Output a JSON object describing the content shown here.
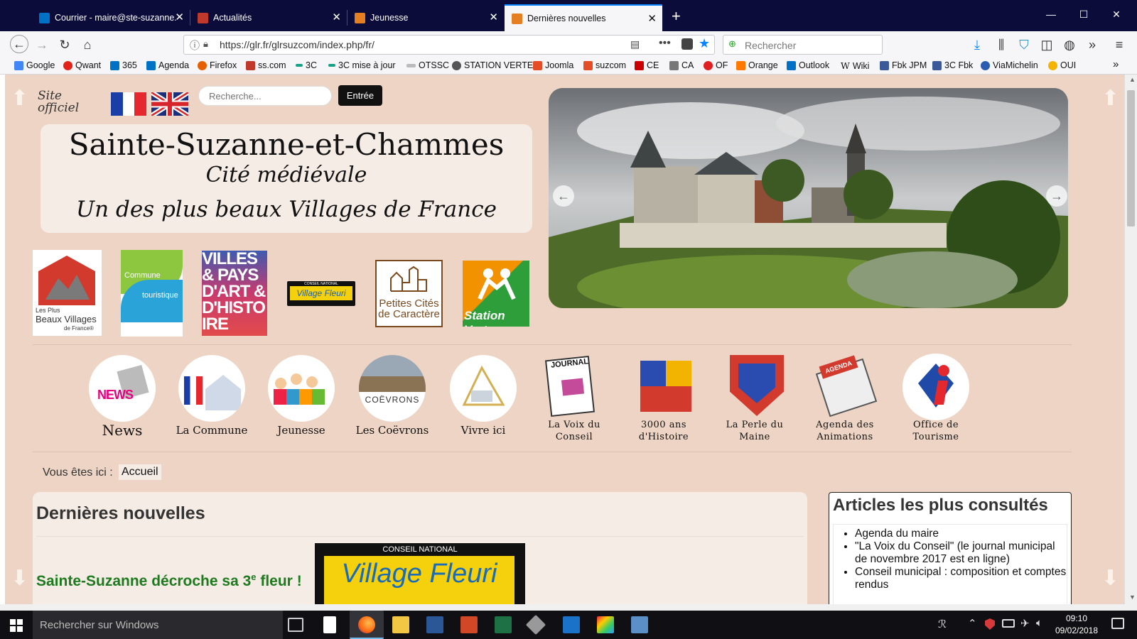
{
  "browser": {
    "tabs": [
      {
        "label": "Courrier - maire@ste-suzanne.",
        "active": false
      },
      {
        "label": "Actualités",
        "active": false
      },
      {
        "label": "Jeunesse",
        "active": false
      },
      {
        "label": "Dernières nouvelles",
        "active": true
      }
    ],
    "url": "https://glr.fr/glrsuzcom/index.php/fr/",
    "search_placeholder": "Rechercher",
    "new_tab": "+",
    "bookmarks": [
      {
        "label": "Google",
        "color": "#4285f4"
      },
      {
        "label": "Qwant",
        "color": "#e2231a"
      },
      {
        "label": "365",
        "color": "#0072c6"
      },
      {
        "label": "Agenda",
        "color": "#0072c6"
      },
      {
        "label": "Firefox",
        "color": "#e66000"
      },
      {
        "label": "ss.com",
        "color": "#c0392b"
      },
      {
        "label": "3C",
        "color": "#16a085"
      },
      {
        "label": "3C mise à jour",
        "color": "#16a085"
      },
      {
        "label": "OTSSC",
        "color": "#999999"
      },
      {
        "label": "STATION VERTE",
        "color": "#555555"
      },
      {
        "label": "Joomla",
        "color": "#e44d26"
      },
      {
        "label": "suzcom",
        "color": "#e44d26"
      },
      {
        "label": "CE",
        "color": "#cc0000"
      },
      {
        "label": "CA",
        "color": "#777777"
      },
      {
        "label": "OF",
        "color": "#e02020"
      },
      {
        "label": "Orange",
        "color": "#ff7900"
      },
      {
        "label": "Outlook",
        "color": "#0072c6"
      },
      {
        "label": "Wiki",
        "color": "#333333"
      },
      {
        "label": "Fbk JPM",
        "color": "#3b5998"
      },
      {
        "label": "3C Fbk",
        "color": "#3b5998"
      },
      {
        "label": "ViaMichelin",
        "color": "#2a5db0"
      },
      {
        "label": "OUI",
        "color": "#f2b400"
      }
    ]
  },
  "site": {
    "site_officiel": "Site officiel",
    "search_placeholder": "Recherche...",
    "search_button": "Entrée",
    "title": "Sainte-Suzanne-et-Chammes",
    "subtitle": "Cité médiévale",
    "tagline": "Un des plus beaux Villages de France",
    "logos": {
      "plus_beaux_1": "Les Plus",
      "plus_beaux_2": "Beaux Villages",
      "plus_beaux_3": "de France®",
      "commune": "Commune",
      "touristique": "touristique",
      "villes_pays": "VILLES & PAYS D'ART & D'HISTOIRE",
      "conseil": "CONSEIL NATIONAL",
      "village_fleuri": "Village Fleuri",
      "petites_cites_1": "Petites Cités",
      "petites_cites_2": "de Caractère",
      "station_verte": "Station Verte"
    },
    "menu": [
      {
        "label": "News",
        "size": "big"
      },
      {
        "label": "La Commune",
        "size": "mid"
      },
      {
        "label": "Jeunesse",
        "size": "mid"
      },
      {
        "label": "Les Coëvrons",
        "size": "mid"
      },
      {
        "label": "Vivre ici",
        "size": "mid"
      },
      {
        "label": "La Voix du Conseil",
        "size": "small"
      },
      {
        "label": "3000 ans d'Histoire",
        "size": "small"
      },
      {
        "label": "La Perle du Maine",
        "size": "small"
      },
      {
        "label": "Agenda des Animations",
        "size": "small"
      },
      {
        "label": "Office de Tourisme",
        "size": "small"
      }
    ],
    "menu_icon_text": {
      "news": "NEWS",
      "journal": "JOURNAL",
      "agenda": "AGENDA",
      "coevrons": "COËVRONS"
    },
    "breadcrumb_label": "Vous êtes ici :",
    "breadcrumb_link": "Accueil",
    "main_heading": "Dernières nouvelles",
    "article_title": "Sainte-Suzanne décroche sa 3",
    "article_sup": "e",
    "article_title_end": " fleur !",
    "article_img_top": "CONSEIL NATIONAL",
    "article_img_main": "Village Fleuri",
    "side_heading": "Articles les plus consultés",
    "side_items": [
      "Agenda du maire",
      "\"La Voix du Conseil\" (le journal municipal de novembre 2017 est en ligne)",
      "Conseil municipal : composition et comptes rendus"
    ]
  },
  "taskbar": {
    "search_text": "Rechercher sur Windows",
    "time": "09:10",
    "date": "09/02/2018"
  }
}
